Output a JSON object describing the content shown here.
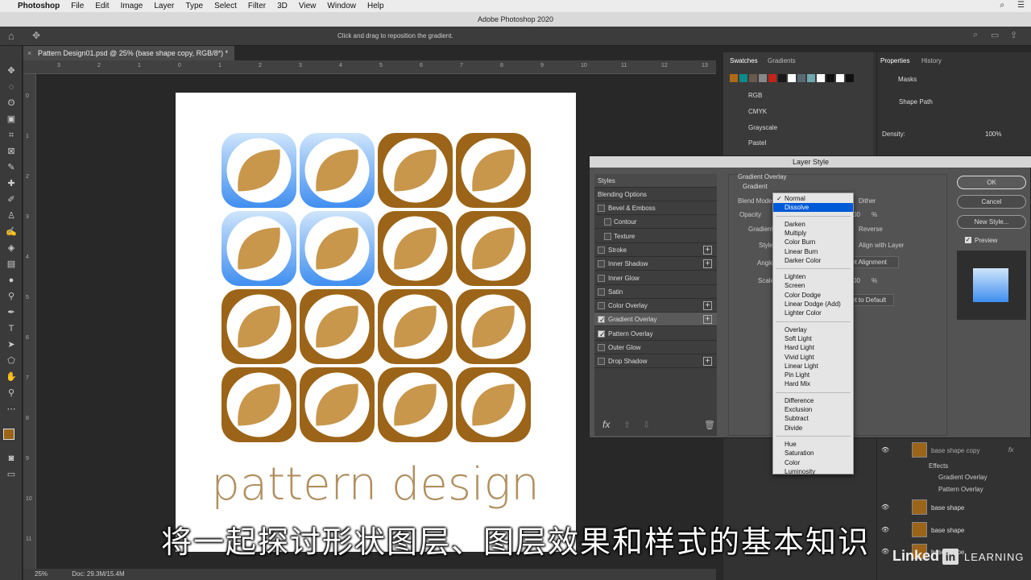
{
  "menubar": {
    "app": "Photoshop",
    "items": [
      "File",
      "Edit",
      "Image",
      "Layer",
      "Type",
      "Select",
      "Filter",
      "3D",
      "View",
      "Window",
      "Help"
    ]
  },
  "titlebar": {
    "title": "Adobe Photoshop 2020"
  },
  "optionsbar": {
    "hint": "Click and drag to reposition the gradient."
  },
  "document": {
    "tab": "Pattern Design01.psd @ 25% (base shape copy, RGB/8*) *",
    "design_text": "pattern design",
    "ruler_h": [
      "3",
      "2",
      "1",
      "0",
      "1",
      "2",
      "3",
      "4",
      "5",
      "6",
      "7",
      "8",
      "9",
      "10",
      "11",
      "12",
      "13"
    ],
    "ruler_v": [
      "0",
      "1",
      "2",
      "3",
      "4",
      "5",
      "6",
      "7",
      "8",
      "9",
      "10",
      "11"
    ],
    "colors": {
      "blue_light": "#cfe5fb",
      "blue_dark": "#3f8ef0",
      "brown": "#9b6418",
      "tan": "#c8974c"
    }
  },
  "statusbar": {
    "zoom": "25%",
    "doc": "Doc: 29.3M/15.4M"
  },
  "panels": {
    "swatches_tab": "Swatches",
    "gradients_tab": "Gradients",
    "properties_tab": "Properties",
    "history_tab": "History",
    "masks_label": "Masks",
    "shape_path_label": "Shape Path",
    "density_label": "Density:",
    "density_value": "100%",
    "folders": [
      "RGB",
      "CMYK",
      "Grayscale",
      "Pastel"
    ],
    "swatch_colors": [
      "#b06a16",
      "#0e8a8a",
      "#6a5a4a",
      "#888888",
      "#c0241b",
      "#181818",
      "#ffffff",
      "#5a6a74",
      "#70a8b0",
      "#ffffff",
      "#111111",
      "#ffffff",
      "#111111"
    ]
  },
  "dialog": {
    "title": "Layer Style",
    "styles_header": "Styles",
    "blending_options": "Blending Options",
    "effects": [
      {
        "label": "Bevel & Emboss",
        "checked": false,
        "plus": false,
        "indent": false
      },
      {
        "label": "Contour",
        "checked": false,
        "plus": false,
        "indent": true
      },
      {
        "label": "Texture",
        "checked": false,
        "plus": false,
        "indent": true
      },
      {
        "label": "Stroke",
        "checked": false,
        "plus": true,
        "indent": false
      },
      {
        "label": "Inner Shadow",
        "checked": false,
        "plus": true,
        "indent": false
      },
      {
        "label": "Inner Glow",
        "checked": false,
        "plus": false,
        "indent": false
      },
      {
        "label": "Satin",
        "checked": false,
        "plus": false,
        "indent": false
      },
      {
        "label": "Color Overlay",
        "checked": false,
        "plus": true,
        "indent": false
      },
      {
        "label": "Gradient Overlay",
        "checked": true,
        "plus": true,
        "indent": false,
        "selected": true
      },
      {
        "label": "Pattern Overlay",
        "checked": true,
        "plus": false,
        "indent": false
      },
      {
        "label": "Outer Glow",
        "checked": false,
        "plus": false,
        "indent": false
      },
      {
        "label": "Drop Shadow",
        "checked": false,
        "plus": true,
        "indent": false
      }
    ],
    "section_title": "Gradient Overlay",
    "section_sub": "Gradient",
    "labels": {
      "blend_mode": "Blend Mode",
      "dither": "Dither",
      "opacity": "Opacity",
      "opacity_value": "00",
      "percent": "%",
      "gradient": "Gradient",
      "reverse": "Reverse",
      "style": "Style",
      "align_with_layer": "Align with Layer",
      "angle": "Angle",
      "reset_alignment": "et Alignment",
      "scale": "Scale",
      "scale_value": "00",
      "reset_default": "et to Default"
    },
    "buttons": {
      "ok": "OK",
      "cancel": "Cancel",
      "new_style": "New Style...",
      "preview": "Preview"
    },
    "fx": "fx"
  },
  "dropdown": {
    "groups": [
      [
        "Normal",
        "Dissolve"
      ],
      [
        "Darken",
        "Multiply",
        "Color Burn",
        "Linear Burn",
        "Darker Color"
      ],
      [
        "Lighten",
        "Screen",
        "Color Dodge",
        "Linear Dodge (Add)",
        "Lighter Color"
      ],
      [
        "Overlay",
        "Soft Light",
        "Hard Light",
        "Vivid Light",
        "Linear Light",
        "Pin Light",
        "Hard Mix"
      ],
      [
        "Difference",
        "Exclusion",
        "Subtract",
        "Divide"
      ],
      [
        "Hue",
        "Saturation",
        "Color",
        "Luminosity"
      ]
    ],
    "checked": "Normal",
    "highlighted": "Dissolve"
  },
  "layers": {
    "layer_name": "base shape copy",
    "effects_label": "Effects",
    "effect_items": [
      "Gradient Overlay",
      "Pattern Overlay"
    ],
    "other_layers": [
      "base shape",
      "base shape",
      "base shape"
    ]
  },
  "subtitle": "将一起探讨形状图层、图层效果和样式的基本知识",
  "watermark": {
    "linked": "Linked",
    "in": "in",
    "learning": "LEARNING"
  }
}
